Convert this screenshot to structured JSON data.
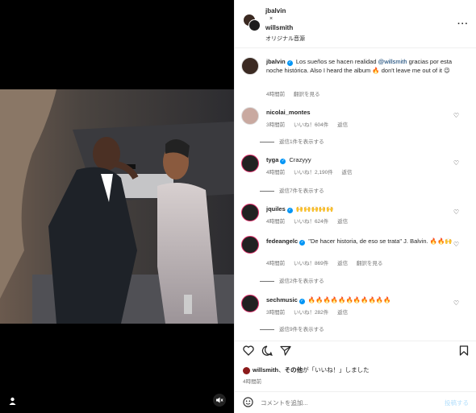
{
  "header": {
    "user1": "jbalvin",
    "joiner": "×",
    "user2": "willsmith",
    "audio": "オリジナル音源"
  },
  "caption": {
    "username": "jbalvin",
    "text": "Los sueños se hacen realidad ",
    "mention": "@willsmith",
    "text2": " gracias por esta noche histórica. Also I heard the album 🔥 don't leave me out of it 😉",
    "time": "4時間前",
    "translate": "翻訳を見る"
  },
  "comments": [
    {
      "username": "nicolai_montes",
      "text": "",
      "time": "3時間前",
      "likes": "いいね！604件",
      "reply": "返信",
      "replies": "返信1件を表示する"
    },
    {
      "username": "tyga",
      "text": "Crazyyy",
      "time": "4時間前",
      "likes": "いいね！2,190件",
      "reply": "返信",
      "replies": "返信7件を表示する"
    },
    {
      "username": "jquiles",
      "text": "🙌🙌🙌🙌🙌",
      "time": "4時間前",
      "likes": "いいね！624件",
      "reply": "返信"
    },
    {
      "username": "fedeangelc",
      "text": "\"De hacer historia, de eso se trata\" J. Balvin. 🔥🔥🙌",
      "time": "4時間前",
      "likes": "いいね！869件",
      "reply": "返信",
      "translate": "翻訳を見る",
      "replies": "返信2件を表示する"
    },
    {
      "username": "sechmusic",
      "text": "🔥🔥🔥🔥🔥🔥🔥🔥🔥🔥🔥",
      "time": "3時間前",
      "likes": "いいね！282件",
      "reply": "返信",
      "replies": "返信9件を表示する"
    }
  ],
  "likes": {
    "user": "willsmith",
    "suffix1": "、",
    "others": "その他",
    "suffix2": "が「いいね！」しました",
    "time": "4時間前"
  },
  "add_comment": {
    "placeholder": "コメントを追加...",
    "post": "投稿する"
  },
  "icons": {
    "more": "more-horizontal-icon",
    "heart": "heart-icon",
    "comment": "comment-icon",
    "share": "share-icon",
    "save": "bookmark-icon",
    "emoji": "emoji-icon",
    "tag": "user-tag-icon",
    "mute": "muted-icon"
  },
  "colors": {
    "verified": "#0095f6",
    "mention": "#00376b",
    "story_ring": "#e1306c",
    "post_disabled": "#b2dffc"
  }
}
